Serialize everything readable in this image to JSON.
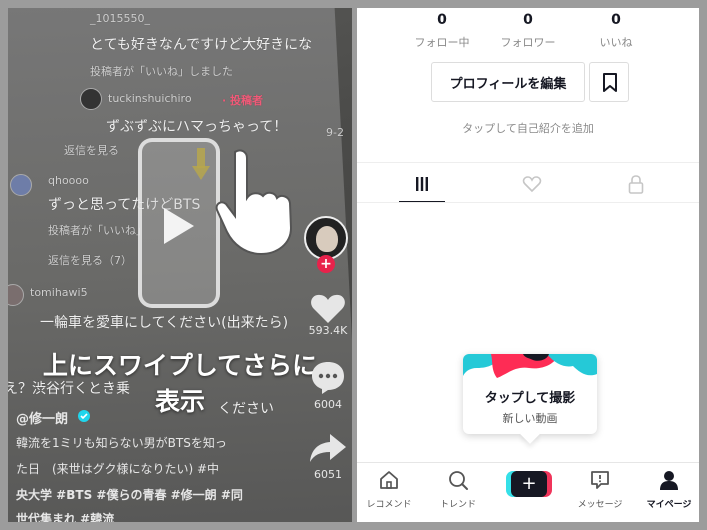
{
  "left": {
    "comments": [
      {
        "text": "_1015550_",
        "cls": "small"
      },
      {
        "text": "とても好きなんですけど大好きにな",
        "cls": "big"
      },
      {
        "text": "投稿者が「いいね」しました",
        "cls": "small"
      },
      {
        "text": "tuckinshuichiro",
        "cls": "small"
      },
      {
        "text": "· 投稿者",
        "cls": "small"
      },
      {
        "text": "ずぶずぶにハマっちゃって！",
        "cls": "big"
      },
      {
        "text": "9-2",
        "cls": "small"
      },
      {
        "text": "返信を見る",
        "cls": "small"
      },
      {
        "text": "qhoooo",
        "cls": "small"
      },
      {
        "text": "ずっと思ってたけどBTS",
        "cls": "big"
      },
      {
        "text": "投稿者が「いいね」",
        "cls": "small"
      },
      {
        "text": "返信を見る（7）",
        "cls": "small"
      },
      {
        "text": "tomihawi5",
        "cls": "small"
      },
      {
        "text": "一輪車を愛車にしてください(出来たら)",
        "cls": "big"
      },
      {
        "text": "え？渋谷行くとき乗",
        "cls": "big"
      },
      {
        "text": "ください",
        "cls": "big"
      }
    ],
    "overlay_line1": "上にスワイプしてさらに",
    "overlay_line2": "表示",
    "like_count": "593.4K",
    "comment_count": "6004",
    "share_count": "6051",
    "author": "@修一朗",
    "caption_lines": [
      "韓流を1ミリも知らない男がBTSを知っ",
      "た日　(来世はグク様になりたい) #中",
      "央大学 #BTS #僕らの青春 #修一朗 #同",
      "世代集まれ #韓流"
    ]
  },
  "right": {
    "stats": [
      {
        "num": "0",
        "label": "フォロー中"
      },
      {
        "num": "0",
        "label": "フォロワー"
      },
      {
        "num": "0",
        "label": "いいね"
      }
    ],
    "edit_profile": "プロフィールを編集",
    "bio_placeholder": "タップして自己紹介を追加",
    "create_bubble": {
      "title": "タップして撮影",
      "subtitle": "新しい動画"
    },
    "nav": [
      {
        "label": "レコメンド",
        "icon": "home-icon"
      },
      {
        "label": "トレンド",
        "icon": "search-icon"
      },
      {
        "label": "",
        "icon": "plus-icon"
      },
      {
        "label": "メッセージ",
        "icon": "message-icon"
      },
      {
        "label": "マイページ",
        "icon": "profile-icon"
      }
    ]
  }
}
